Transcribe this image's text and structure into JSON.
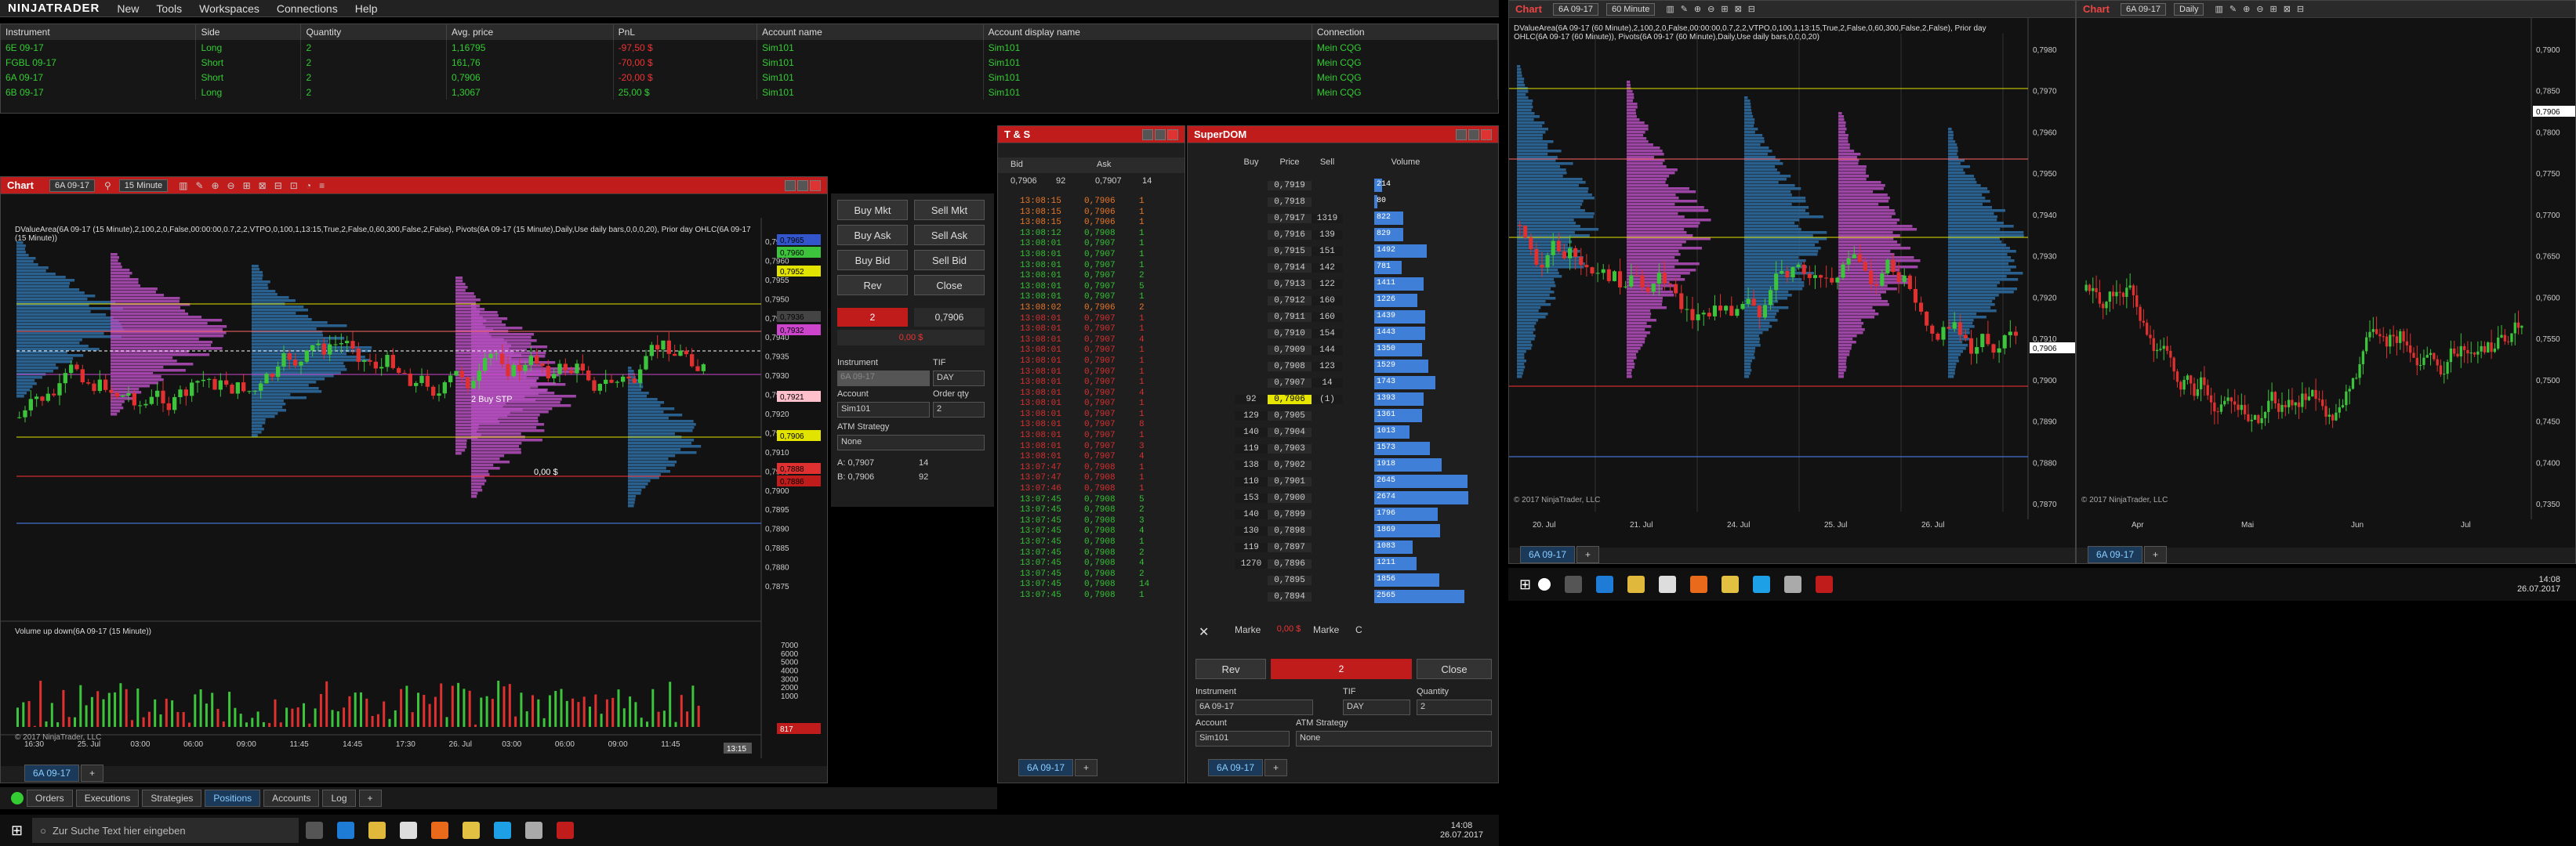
{
  "menu": {
    "logo": "NINJATRADER",
    "items": [
      "New",
      "Tools",
      "Workspaces",
      "Connections",
      "Help"
    ]
  },
  "positions": {
    "headers": [
      "Instrument",
      "Side",
      "Quantity",
      "Avg. price",
      "PnL",
      "Account name",
      "Account display name",
      "Connection"
    ],
    "rows": [
      [
        "6E 09-17",
        "Long",
        "2",
        "1,16795",
        "-97,50 $",
        "Sim101",
        "Sim101",
        "Mein CQG"
      ],
      [
        "FGBL 09-17",
        "Short",
        "2",
        "161,76",
        "-70,00 $",
        "Sim101",
        "Sim101",
        "Mein CQG"
      ],
      [
        "6A 09-17",
        "Short",
        "2",
        "0,7906",
        "-20,00 $",
        "Sim101",
        "Sim101",
        "Mein CQG"
      ],
      [
        "6B 09-17",
        "Long",
        "2",
        "1,3067",
        "25,00 $",
        "Sim101",
        "Sim101",
        "Mein CQG"
      ]
    ]
  },
  "bottom_tabs": [
    "Orders",
    "Executions",
    "Strategies",
    "Positions",
    "Accounts",
    "Log"
  ],
  "chart1": {
    "title": "Chart",
    "instrument": "6A 09-17",
    "interval": "15 Minute",
    "indicator_text": "DValueArea(6A 09-17 (15 Minute),2,100,2,0,False,00:00:00,0.7,2,2,VTPO,0,100,1,13:15,True,2,False,0,60,300,False,2,False), Pivots(6A 09-17 (15 Minute),Daily,Use daily bars,0,0,0,20), Prior day OHLC(6A 09-17 (15 Minute))",
    "volume_label": "Volume up down(6A 09-17 (15 Minute))",
    "copyright": "© 2017 NinjaTrader, LLC",
    "price_ticks": [
      "0,7965",
      "0,7960",
      "0,7955",
      "0,7950",
      "0,7945",
      "0,7940",
      "0,7935",
      "0,7930",
      "0,7925",
      "0,7920",
      "0,7915",
      "0,7910",
      "0,7905",
      "0,7900",
      "0,7895",
      "0,7890",
      "0,7885",
      "0,7880",
      "0,7875"
    ],
    "time_ticks": [
      "16:30",
      "25. Jul",
      "03:00",
      "06:00",
      "09:00",
      "11:45",
      "14:45",
      "17:30",
      "26. Jul",
      "03:00",
      "06:00",
      "09:00",
      "11:45"
    ],
    "time_marker": "13:15",
    "vol_ticks": [
      "7000",
      "6000",
      "5000",
      "4000",
      "3000",
      "2000",
      "1000"
    ],
    "vol_marker": "817",
    "order_label": "2  Buy STP",
    "pnl_tag": "0,00 $",
    "tab": "6A 09-17",
    "tags": [
      "0,7965",
      "0,7960",
      "0,7952",
      "0,7936",
      "0,7932",
      "0,7921",
      "0,7906",
      "0,7888",
      "0,7886"
    ]
  },
  "chart_trader": {
    "buttons": [
      "Buy Mkt",
      "Sell Mkt",
      "Buy Ask",
      "Sell Ask",
      "Buy Bid",
      "Sell Bid",
      "Rev",
      "Close"
    ],
    "qty_pos": "2",
    "avg": "0,7906",
    "pnl": "0,00 $",
    "instrument_label": "Instrument",
    "instrument_value": "6A 09-17",
    "tif_label": "TIF",
    "tif_value": "DAY",
    "account_label": "Account",
    "account_value": "Sim101",
    "orderqty_label": "Order qty",
    "orderqty_value": "2",
    "atm_label": "ATM Strategy",
    "atm_value": "None",
    "ask_line": "A:  0,7907",
    "ask_size": "14",
    "bid_line": "B:  0,7906",
    "bid_size": "92"
  },
  "ts": {
    "title": "T & S",
    "bid_header": "Bid",
    "ask_header": "Ask",
    "bid": "0,7906",
    "bid_size": "92",
    "ask": "0,7907",
    "ask_size": "14",
    "tab": "6A 09-17",
    "rows": [
      [
        "13:08:15",
        "0,7906",
        "1",
        "o"
      ],
      [
        "13:08:15",
        "0,7906",
        "1",
        "o"
      ],
      [
        "13:08:15",
        "0,7906",
        "1",
        "o"
      ],
      [
        "13:08:12",
        "0,7908",
        "1",
        "g"
      ],
      [
        "13:08:01",
        "0,7907",
        "1",
        "g"
      ],
      [
        "13:08:01",
        "0,7907",
        "1",
        "g"
      ],
      [
        "13:08:01",
        "0,7907",
        "1",
        "g"
      ],
      [
        "13:08:01",
        "0,7907",
        "2",
        "g"
      ],
      [
        "13:08:01",
        "0,7907",
        "5",
        "g"
      ],
      [
        "13:08:01",
        "0,7907",
        "1",
        "g"
      ],
      [
        "13:08:02",
        "0,7906",
        "2",
        "o"
      ],
      [
        "13:08:01",
        "0,7907",
        "1",
        "r"
      ],
      [
        "13:08:01",
        "0,7907",
        "1",
        "r"
      ],
      [
        "13:08:01",
        "0,7907",
        "4",
        "r"
      ],
      [
        "13:08:01",
        "0,7907",
        "1",
        "r"
      ],
      [
        "13:08:01",
        "0,7907",
        "1",
        "r"
      ],
      [
        "13:08:01",
        "0,7907",
        "1",
        "r"
      ],
      [
        "13:08:01",
        "0,7907",
        "1",
        "r"
      ],
      [
        "13:08:01",
        "0,7907",
        "4",
        "r"
      ],
      [
        "13:08:01",
        "0,7907",
        "1",
        "r"
      ],
      [
        "13:08:01",
        "0,7907",
        "1",
        "r"
      ],
      [
        "13:08:01",
        "0,7907",
        "8",
        "r"
      ],
      [
        "13:08:01",
        "0,7907",
        "1",
        "r"
      ],
      [
        "13:08:01",
        "0,7907",
        "3",
        "r"
      ],
      [
        "13:08:01",
        "0,7907",
        "4",
        "r"
      ],
      [
        "13:07:47",
        "0,7908",
        "1",
        "r"
      ],
      [
        "13:07:47",
        "0,7908",
        "1",
        "r"
      ],
      [
        "13:07:46",
        "0,7908",
        "1",
        "r"
      ],
      [
        "13:07:45",
        "0,7908",
        "5",
        "g"
      ],
      [
        "13:07:45",
        "0,7908",
        "2",
        "g"
      ],
      [
        "13:07:45",
        "0,7908",
        "3",
        "g"
      ],
      [
        "13:07:45",
        "0,7908",
        "4",
        "g"
      ],
      [
        "13:07:45",
        "0,7908",
        "1",
        "g"
      ],
      [
        "13:07:45",
        "0,7908",
        "2",
        "g"
      ],
      [
        "13:07:45",
        "0,7908",
        "4",
        "g"
      ],
      [
        "13:07:45",
        "0,7908",
        "2",
        "g"
      ],
      [
        "13:07:45",
        "0,7908",
        "14",
        "g"
      ],
      [
        "13:07:45",
        "0,7908",
        "1",
        "g"
      ]
    ]
  },
  "dom": {
    "title": "SuperDOM",
    "headers": [
      "Buy",
      "Price",
      "Sell",
      "Volume"
    ],
    "rows": [
      [
        "",
        "0,7919",
        "",
        "214"
      ],
      [
        "",
        "0,7918",
        "",
        "80"
      ],
      [
        "",
        "0,7917",
        "1319",
        "822"
      ],
      [
        "",
        "0,7916",
        "139",
        "829"
      ],
      [
        "",
        "0,7915",
        "151",
        "1492"
      ],
      [
        "",
        "0,7914",
        "142",
        "781"
      ],
      [
        "",
        "0,7913",
        "122",
        "1411"
      ],
      [
        "",
        "0,7912",
        "160",
        "1226"
      ],
      [
        "",
        "0,7911",
        "160",
        "1439"
      ],
      [
        "",
        "0,7910",
        "154",
        "1443"
      ],
      [
        "",
        "0,7909",
        "144",
        "1350"
      ],
      [
        "",
        "0,7908",
        "123",
        "1529"
      ],
      [
        "",
        "0,7907",
        "14",
        "1743"
      ],
      [
        "92",
        "0,7906",
        "(1)",
        "1393"
      ],
      [
        "129",
        "0,7905",
        "",
        "1361"
      ],
      [
        "140",
        "0,7904",
        "",
        "1013"
      ],
      [
        "119",
        "0,7903",
        "",
        "1573"
      ],
      [
        "138",
        "0,7902",
        "",
        "1918"
      ],
      [
        "110",
        "0,7901",
        "",
        "2645"
      ],
      [
        "153",
        "0,7900",
        "",
        "2674"
      ],
      [
        "140",
        "0,7899",
        "",
        "1796"
      ],
      [
        "130",
        "0,7898",
        "",
        "1869"
      ],
      [
        "119",
        "0,7897",
        "",
        "1083"
      ],
      [
        "1270",
        "0,7896",
        "",
        "1211"
      ],
      [
        "",
        "0,7895",
        "",
        "1856"
      ],
      [
        "",
        "0,7894",
        "",
        "2565"
      ]
    ],
    "market_left": "Marke",
    "pnl": "0,00 $",
    "market_right": "Marke",
    "market_c": "C",
    "rev": "Rev",
    "qty": "2",
    "close": "Close",
    "instrument_label": "Instrument",
    "instrument_value": "6A 09-17",
    "tif_label": "TIF",
    "tif_value": "DAY",
    "quantity_label": "Quantity",
    "quantity_value": "2",
    "account_label": "Account",
    "account_value": "Sim101",
    "atm_label": "ATM Strategy",
    "atm_value": "None",
    "tab": "6A 09-17"
  },
  "chart2": {
    "title": "Chart",
    "instrument": "6A 09-17",
    "interval": "60 Minute",
    "indicator_text": "DValueArea(6A 09-17 (60 Minute),2,100,2,0,False,00:00:00,0.7,2,2,VTPO,0,100,1,13:15,True,2,False,0,60,300,False,2,False), Prior day OHLC(6A 09-17 (60 Minute)), Pivots(6A 09-17 (60 Minute),Daily,Use daily bars,0,0,0,20)",
    "copyright": "© 2017 NinjaTrader, LLC",
    "price_ticks": [
      "0,7980",
      "0,7970",
      "0,7960",
      "0,7950",
      "0,7940",
      "0,7930",
      "0,7920",
      "0,7910",
      "0,7900",
      "0,7890",
      "0,7880",
      "0,7870"
    ],
    "time_ticks": [
      "20. Jul",
      "21. Jul",
      "24. Jul",
      "25. Jul",
      "26. Jul"
    ],
    "price_tag": "0,7906",
    "tab": "6A 09-17"
  },
  "chart3": {
    "title": "Chart",
    "instrument": "6A 09-17",
    "interval": "Daily",
    "copyright": "© 2017 NinjaTrader, LLC",
    "price_ticks": [
      "0,7900",
      "0,7850",
      "0,7800",
      "0,7750",
      "0,7700",
      "0,7650",
      "0,7600",
      "0,7550",
      "0,7500",
      "0,7450",
      "0,7400",
      "0,7350"
    ],
    "time_ticks": [
      "Apr",
      "Mai",
      "Jun",
      "Jul"
    ],
    "price_tag": "0,7906",
    "tab": "6A 09-17"
  },
  "taskbar_left": {
    "search_placeholder": "Zur Suche Text hier eingeben",
    "time": "14:08",
    "date": "26.07.2017"
  },
  "taskbar_right": {
    "time": "14:08",
    "date": "26.07.2017"
  },
  "colors": {
    "accent_red": "#c11c1c",
    "bull": "#3cc43c",
    "bear": "#e03030",
    "profile_blue": "#2f6fa3",
    "profile_magenta": "#b54fbe"
  }
}
